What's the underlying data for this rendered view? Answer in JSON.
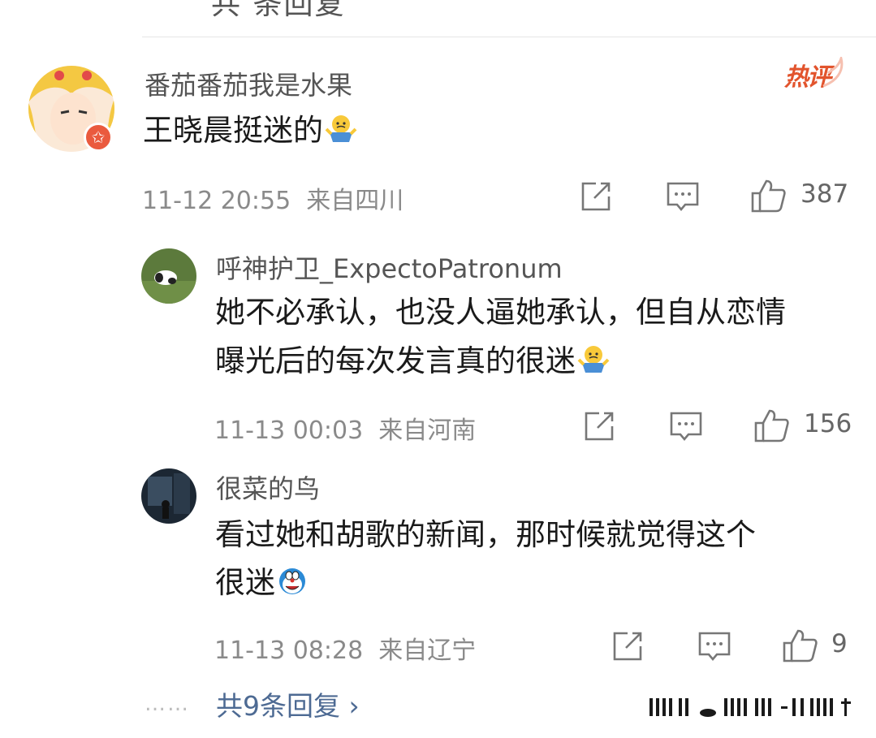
{
  "top_partial_text": "共 条回复",
  "hot_badge": "热评",
  "comment": {
    "user": "番茄番茄我是水果",
    "text": "王晓晨挺迷的",
    "emoji": "shrug",
    "time": "11-12 20:55",
    "location": "来自四川",
    "likes": "387"
  },
  "replies": [
    {
      "user": "呼神护卫_ExpectoPatronum",
      "line1": "她不必承认，也没人逼她承认，但自从恋情",
      "line2": "曝光后的每次发言真的很迷",
      "emoji": "shrug",
      "time": "11-13 00:03",
      "location": "来自河南",
      "likes": "156"
    },
    {
      "user": "很菜的鸟",
      "line1": "看过她和胡歌的新闻，那时候就觉得这个",
      "line2": "很迷",
      "emoji": "doraemon",
      "time": "11-13 08:28",
      "location": "来自辽宁",
      "likes": "9"
    }
  ],
  "more_dots": "……",
  "more_replies": "共9条回复 ›",
  "icons": [
    "share-icon",
    "comment-icon",
    "like-icon"
  ],
  "colors": {
    "link": "#4d6a93",
    "hot": "#e2542d",
    "meta": "#8a8a8a"
  }
}
